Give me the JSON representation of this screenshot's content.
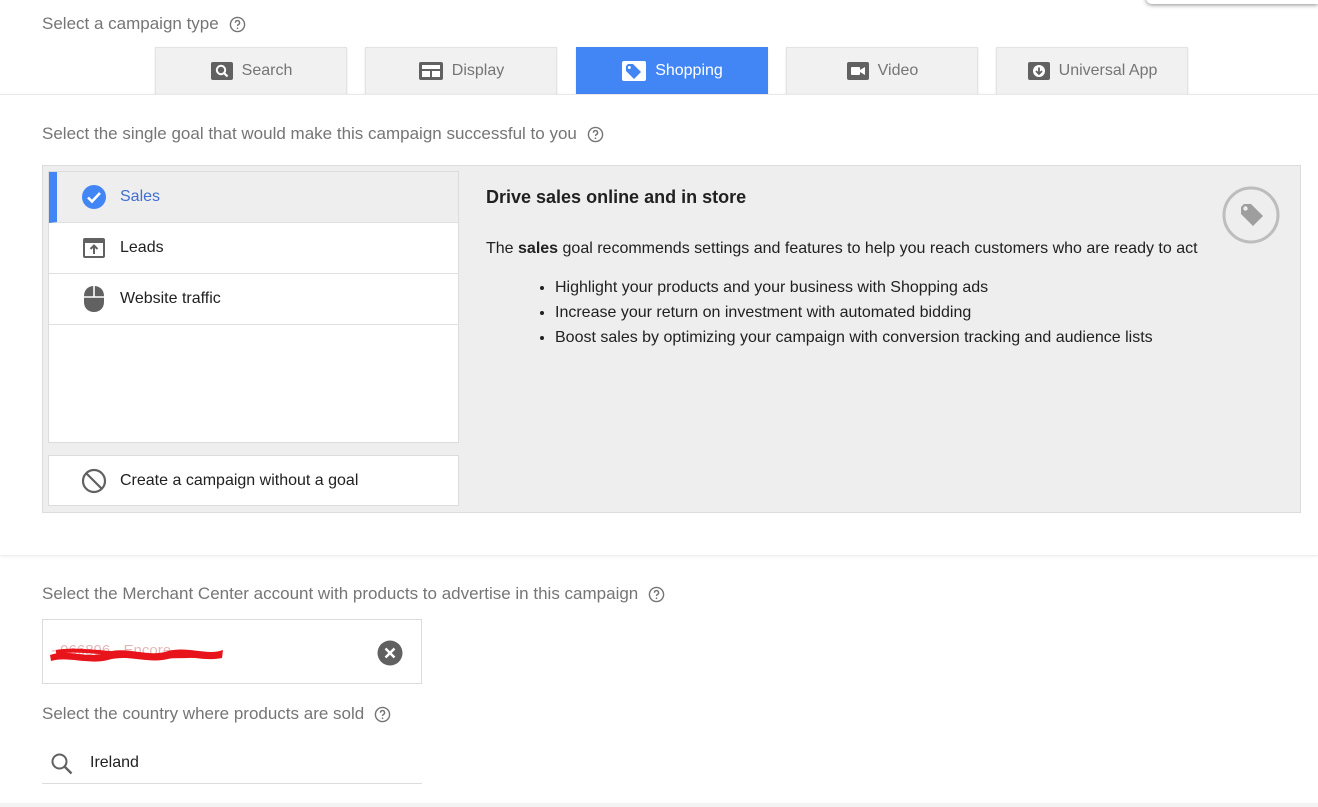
{
  "campaign_type": {
    "label": "Select a campaign type",
    "tabs": [
      {
        "label": "Search",
        "icon": "search-icon",
        "active": false
      },
      {
        "label": "Display",
        "icon": "display-icon",
        "active": false
      },
      {
        "label": "Shopping",
        "icon": "tag-icon",
        "active": true
      },
      {
        "label": "Video",
        "icon": "video-camera-icon",
        "active": false
      },
      {
        "label": "Universal App",
        "icon": "download-icon",
        "active": false
      }
    ]
  },
  "goal": {
    "label": "Select the single goal that would make this campaign successful to you",
    "items": [
      {
        "label": "Sales",
        "icon": "check-circle-icon",
        "selected": true
      },
      {
        "label": "Leads",
        "icon": "upload-box-icon",
        "selected": false
      },
      {
        "label": "Website traffic",
        "icon": "mouse-icon",
        "selected": false
      }
    ],
    "no_goal_label": "Create a campaign without a goal",
    "detail": {
      "title": "Drive sales online and in store",
      "desc_prefix": "The",
      "desc_bold": "sales",
      "desc_suffix": "goal recommends settings and features to help you reach customers who are ready to act",
      "bullets": [
        "Highlight your products and your business with Shopping ads",
        "Increase your return on investment with automated bidding",
        "Boost sales by optimizing your campaign with conversion tracking and audience lists"
      ]
    }
  },
  "merchant": {
    "label": "Select the Merchant Center account with products to advertise in this campaign",
    "value": "- 966896 - Encore"
  },
  "country": {
    "label": "Select the country where products are sold",
    "value": "Ireland"
  },
  "colors": {
    "accent": "#4285f4",
    "selected_text": "#3f6fd0",
    "muted_text": "#757575",
    "redaction": "#e8141b"
  }
}
